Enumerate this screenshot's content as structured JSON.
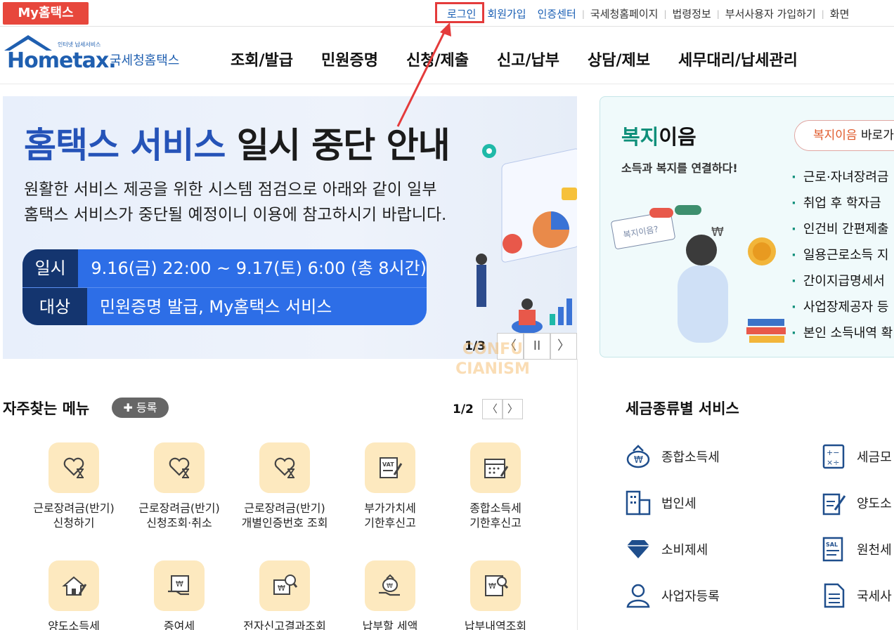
{
  "util": {
    "my_label": "My홈택스",
    "login": "로그인",
    "signup": "회원가입",
    "cert": "인증센터",
    "nts_home": "국세청홈페이지",
    "law": "법령정보",
    "dept_user": "부서사용자 가입하기",
    "more": "화면"
  },
  "header": {
    "logo_small": "인터넷 납세서비스",
    "logo_main": "Hometax.",
    "logo_kr": "국세청홈택스",
    "nav": [
      "조회/발급",
      "민원증명",
      "신청/제출",
      "신고/납부",
      "상담/제보",
      "세무대리/납세관리"
    ]
  },
  "banner": {
    "title_blue": "홈택스 서비스",
    "title_dark": "일시 중단 안내",
    "desc": "원활한 서비스 제공을 위한 시스템 점검으로 아래와 같이 일부\n홈택스 서비스가 중단될 예정이니 이용에 참고하시기 바랍니다.",
    "row1_key": "일시",
    "row1_val": "9.16(금) 22:00 ~ 9.17(토) 6:00 (총 8시간)",
    "row2_key": "대상",
    "row2_val": "민원증명 발급, My홈택스 서비스",
    "page": "1/3",
    "prev": "〈",
    "pause": "II",
    "next": "〉"
  },
  "welfare": {
    "title_green": "복지",
    "title_dark": "이음",
    "subtitle": "소득과 복지를 연결하다!",
    "link_red": "복지이음",
    "link_rest": " 바로가기",
    "illustration_text": "복지이음?",
    "items": [
      "근로·자녀장려금",
      "취업 후 학자금",
      "인건비 간편제출",
      "일용근로소득 지",
      "간이지급명세서",
      "사업장제공자 등",
      "본인 소득내역 확"
    ]
  },
  "favorites": {
    "title": "자주찾는 메뉴",
    "add": "등록",
    "page": "1/2",
    "prev": "〈",
    "next": "〉",
    "items": [
      {
        "label": "근로장려금(반기)\n신청하기",
        "icon": "heart-hourglass-icon"
      },
      {
        "label": "근로장려금(반기)\n신청조회·취소",
        "icon": "heart-hourglass-icon"
      },
      {
        "label": "근로장려금(반기)\n개별인증번호 조회",
        "icon": "heart-hourglass-icon"
      },
      {
        "label": "부가가치세\n기한후신고",
        "icon": "vat-doc-icon"
      },
      {
        "label": "종합소득세\n기한후신고",
        "icon": "calendar-pen-icon"
      },
      {
        "label": "양도소득세",
        "icon": "house-pen-icon"
      },
      {
        "label": "증여세",
        "icon": "gift-doc-icon"
      },
      {
        "label": "전자신고결과조회",
        "icon": "won-search-icon"
      },
      {
        "label": "납부할 세액",
        "icon": "moneybag-hand-icon"
      },
      {
        "label": "납부내역조회",
        "icon": "won-doc-search-icon"
      }
    ]
  },
  "tax_service": {
    "title": "세금종류별 서비스",
    "items": [
      {
        "label": "종합소득세",
        "icon": "money-bag-icon"
      },
      {
        "label": "세금모",
        "icon": "calculator-icon"
      },
      {
        "label": "법인세",
        "icon": "building-icon"
      },
      {
        "label": "양도소",
        "icon": "doc-pen-icon"
      },
      {
        "label": "소비제세",
        "icon": "diamond-icon"
      },
      {
        "label": "원천세",
        "icon": "salary-doc-icon"
      },
      {
        "label": "사업자등록",
        "icon": "person-icon"
      },
      {
        "label": "국세사",
        "icon": "document-icon"
      }
    ]
  },
  "watermark": {
    "line1": "CONFU",
    "line2": "CIANISM"
  },
  "colors": {
    "brand_red": "#e7473c",
    "link_blue": "#1a5fb4",
    "banner_blue": "#2553b8",
    "welfare_green": "#0f8f7a",
    "annotation_red": "#e43b3b"
  }
}
